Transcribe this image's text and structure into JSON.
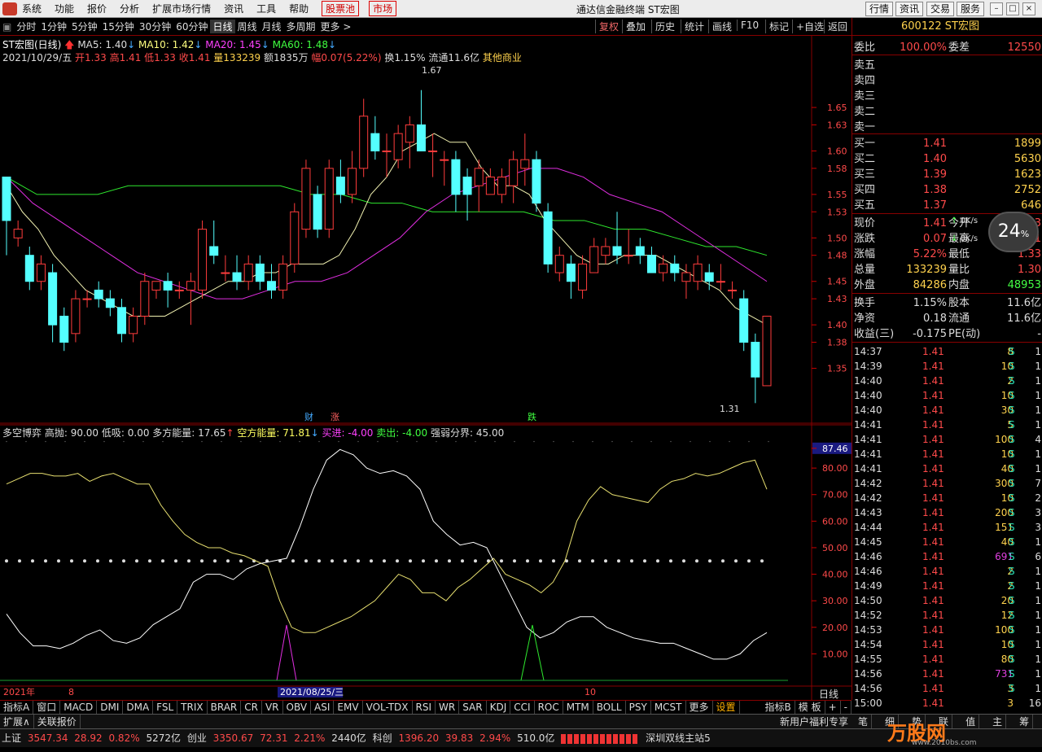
{
  "menu": {
    "items": [
      "系统",
      "功能",
      "报价",
      "分析",
      "扩展市场行情",
      "资讯",
      "工具",
      "帮助"
    ],
    "hl1": "股票池",
    "hl2": "市场",
    "window_title": "通达信金融终端 ST宏图",
    "right_buttons": [
      "行情",
      "资讯",
      "交易",
      "服务"
    ]
  },
  "toolbar": {
    "periods": [
      "分时",
      "1分钟",
      "5分钟",
      "15分钟",
      "30分钟",
      "60分钟",
      "日线",
      "周线",
      "月线",
      "多周期",
      "更多 >"
    ],
    "active": "日线",
    "right_buttons": [
      "复权",
      "叠加",
      "历史",
      "统计",
      "画线",
      "F10",
      "标记",
      "+自选",
      "返回"
    ]
  },
  "chart_header": {
    "name": "ST宏图(日线)",
    "ma5": "MA5: 1.40",
    "ma10": "MA10: 1.42",
    "ma20": "MA20: 1.45",
    "ma60": "MA60: 1.48",
    "date": "2021/10/29/五",
    "open": "开1.33",
    "high": "高1.41",
    "low": "低1.33",
    "close": "收1.41",
    "vol": "量133239",
    "amt": "额1835万",
    "chg": "幅0.07(5.22%)",
    "turnover": "换1.15%",
    "float": "流通11.6亿",
    "sector": "其他商业"
  },
  "indicator_header": {
    "name": "多空博弈",
    "high_throw": "高抛: 90.00",
    "low_buy": "低吸: 0.00",
    "long_power": "多方能量: 17.65",
    "short_power": "空方能量: 71.81",
    "buy": "买进: -4.00",
    "sell": "卖出: -4.00",
    "border": "强弱分界: 45.00"
  },
  "chart_data": {
    "type": "candlestick",
    "y_ticks": [
      1.65,
      1.63,
      1.6,
      1.58,
      1.55,
      1.53,
      1.5,
      1.48,
      1.45,
      1.43,
      1.4,
      1.38,
      1.35
    ],
    "ylim": [
      1.3,
      1.68
    ],
    "max_label": "1.67",
    "min_label": "1.31",
    "x_labels": [
      "2021年",
      "8",
      "2021/08/25/三",
      "10"
    ],
    "markers": [
      "财",
      "涨",
      "跌"
    ],
    "candles": [
      [
        1.57,
        1.52,
        1.56,
        1.48
      ],
      [
        1.5,
        1.51,
        1.52,
        1.49
      ],
      [
        1.48,
        1.45,
        1.49,
        1.44
      ],
      [
        1.45,
        1.47,
        1.48,
        1.44
      ],
      [
        1.46,
        1.4,
        1.47,
        1.38
      ],
      [
        1.41,
        1.38,
        1.42,
        1.37
      ],
      [
        1.39,
        1.43,
        1.44,
        1.38
      ],
      [
        1.43,
        1.43,
        1.44,
        1.42
      ],
      [
        1.44,
        1.43,
        1.45,
        1.42
      ],
      [
        1.43,
        1.42,
        1.44,
        1.41
      ],
      [
        1.42,
        1.39,
        1.43,
        1.38
      ],
      [
        1.39,
        1.41,
        1.42,
        1.38
      ],
      [
        1.41,
        1.45,
        1.46,
        1.4
      ],
      [
        1.44,
        1.45,
        1.45,
        1.43
      ],
      [
        1.45,
        1.44,
        1.46,
        1.42
      ],
      [
        1.44,
        1.44,
        1.45,
        1.43
      ],
      [
        1.44,
        1.45,
        1.46,
        1.4
      ],
      [
        1.44,
        1.51,
        1.52,
        1.43
      ],
      [
        1.49,
        1.48,
        1.52,
        1.47
      ],
      [
        1.46,
        1.46,
        1.48,
        1.45
      ],
      [
        1.46,
        1.45,
        1.48,
        1.44
      ],
      [
        1.45,
        1.47,
        1.48,
        1.44
      ],
      [
        1.47,
        1.45,
        1.48,
        1.44
      ],
      [
        1.45,
        1.44,
        1.47,
        1.43
      ],
      [
        1.44,
        1.47,
        1.48,
        1.43
      ],
      [
        1.47,
        1.53,
        1.54,
        1.46
      ],
      [
        1.51,
        1.58,
        1.59,
        1.5
      ],
      [
        1.55,
        1.51,
        1.56,
        1.5
      ],
      [
        1.51,
        1.58,
        1.59,
        1.5
      ],
      [
        1.57,
        1.55,
        1.59,
        1.54
      ],
      [
        1.55,
        1.58,
        1.6,
        1.54
      ],
      [
        1.58,
        1.64,
        1.66,
        1.57
      ],
      [
        1.62,
        1.6,
        1.64,
        1.59
      ],
      [
        1.6,
        1.6,
        1.62,
        1.57
      ],
      [
        1.59,
        1.62,
        1.63,
        1.58
      ],
      [
        1.61,
        1.63,
        1.64,
        1.58
      ],
      [
        1.63,
        1.6,
        1.67,
        1.6
      ],
      [
        1.6,
        1.6,
        1.62,
        1.57
      ],
      [
        1.59,
        1.59,
        1.6,
        1.56
      ],
      [
        1.59,
        1.55,
        1.6,
        1.53
      ],
      [
        1.57,
        1.55,
        1.58,
        1.52
      ],
      [
        1.56,
        1.58,
        1.59,
        1.53
      ],
      [
        1.55,
        1.57,
        1.58,
        1.55
      ],
      [
        1.55,
        1.57,
        1.58,
        1.54
      ],
      [
        1.56,
        1.59,
        1.6,
        1.54
      ],
      [
        1.58,
        1.59,
        1.62,
        1.56
      ],
      [
        1.59,
        1.54,
        1.6,
        1.53
      ],
      [
        1.53,
        1.47,
        1.54,
        1.46
      ],
      [
        1.46,
        1.48,
        1.49,
        1.45
      ],
      [
        1.47,
        1.45,
        1.48,
        1.43
      ],
      [
        1.44,
        1.47,
        1.48,
        1.43
      ],
      [
        1.46,
        1.49,
        1.5,
        1.46
      ],
      [
        1.48,
        1.49,
        1.5,
        1.47
      ],
      [
        1.49,
        1.48,
        1.53,
        1.47
      ],
      [
        1.48,
        1.48,
        1.51,
        1.47
      ],
      [
        1.49,
        1.48,
        1.5,
        1.47
      ],
      [
        1.48,
        1.46,
        1.49,
        1.46
      ],
      [
        1.46,
        1.47,
        1.48,
        1.45
      ],
      [
        1.47,
        1.46,
        1.48,
        1.45
      ],
      [
        1.45,
        1.46,
        1.47,
        1.43
      ],
      [
        1.45,
        1.47,
        1.48,
        1.44
      ],
      [
        1.46,
        1.45,
        1.47,
        1.44
      ],
      [
        1.45,
        1.45,
        1.47,
        1.44
      ],
      [
        1.44,
        1.44,
        1.45,
        1.43
      ],
      [
        1.43,
        1.38,
        1.44,
        1.37
      ],
      [
        1.38,
        1.34,
        1.39,
        1.31
      ],
      [
        1.33,
        1.41,
        1.41,
        1.33
      ]
    ],
    "ind_ticks": [
      87.46,
      80.0,
      70.0,
      60.0,
      50.0,
      40.0,
      30.0,
      20.0,
      10.0
    ],
    "long_line": [
      74,
      76,
      78,
      78,
      77,
      77,
      78,
      75,
      77,
      78,
      76,
      74,
      74,
      66,
      60,
      55,
      52,
      50,
      50,
      48,
      47,
      45,
      43,
      30,
      20,
      18,
      18,
      20,
      22,
      24,
      27,
      30,
      35,
      40,
      38,
      33,
      33,
      30,
      35,
      38,
      42,
      46,
      40,
      38,
      36,
      33,
      37,
      45,
      60,
      68,
      73,
      70,
      69,
      68,
      67,
      72,
      75,
      76,
      78,
      77,
      78,
      80,
      82,
      83,
      72
    ],
    "short_line": [
      25,
      18,
      13,
      13,
      12,
      14,
      17,
      19,
      15,
      14,
      16,
      21,
      24,
      27,
      37,
      40,
      40,
      38,
      42,
      44,
      45,
      46,
      58,
      72,
      83,
      87,
      85,
      80,
      78,
      79,
      77,
      72,
      60,
      55,
      51,
      52,
      50,
      40,
      30,
      20,
      16,
      18,
      22,
      24,
      24,
      20,
      18,
      16,
      15,
      14,
      14,
      12,
      10,
      8,
      8,
      10,
      15,
      18
    ],
    "ma5": [
      1.56,
      1.53,
      1.51,
      1.48,
      1.46,
      1.44,
      1.43,
      1.42,
      1.41,
      1.41,
      1.41,
      1.42,
      1.43,
      1.44,
      1.45,
      1.45,
      1.46,
      1.46,
      1.47,
      1.47,
      1.47,
      1.48,
      1.51,
      1.55,
      1.57,
      1.6,
      1.61,
      1.62,
      1.61,
      1.61,
      1.58,
      1.56,
      1.56,
      1.55,
      1.52,
      1.5,
      1.48,
      1.47,
      1.47,
      1.48,
      1.48,
      1.48,
      1.47,
      1.46,
      1.45,
      1.44,
      1.42,
      1.41,
      1.4
    ],
    "ma60": [
      1.57,
      1.55,
      1.55,
      1.55,
      1.56,
      1.56,
      1.56,
      1.56,
      1.56,
      1.56,
      1.55,
      1.55,
      1.54,
      1.54,
      1.53,
      1.53,
      1.53,
      1.53,
      1.52,
      1.52,
      1.51,
      1.51,
      1.5,
      1.49,
      1.49,
      1.48
    ],
    "ma20": [
      1.57,
      1.54,
      1.52,
      1.5,
      1.48,
      1.46,
      1.45,
      1.44,
      1.43,
      1.43,
      1.44,
      1.45,
      1.45,
      1.46,
      1.48,
      1.5,
      1.53,
      1.55,
      1.56,
      1.57,
      1.58,
      1.58,
      1.57,
      1.55,
      1.54,
      1.53,
      1.51,
      1.49,
      1.47,
      1.45
    ]
  },
  "quote": {
    "code": "600122 ST宏图",
    "weibi_label": "委比",
    "weibi": "100.00%",
    "weicha_label": "委差",
    "weicha": "12550",
    "asks": [
      "卖五",
      "卖四",
      "卖三",
      "卖二",
      "卖一"
    ],
    "bids": [
      {
        "l": "买一",
        "p": "1.41",
        "v": "1899"
      },
      {
        "l": "买二",
        "p": "1.40",
        "v": "5630"
      },
      {
        "l": "买三",
        "p": "1.39",
        "v": "1623"
      },
      {
        "l": "买四",
        "p": "1.38",
        "v": "2752"
      },
      {
        "l": "买五",
        "p": "1.37",
        "v": "646"
      }
    ],
    "stats1": [
      {
        "l": "现价",
        "v": "1.41",
        "l2": "今开",
        "v2": "1.33"
      },
      {
        "l": "涨跌",
        "v": "0.07",
        "l2": "最高",
        "v2": "1.41"
      },
      {
        "l": "涨幅",
        "v": "5.22%",
        "l2": "最低",
        "v2": "1.33"
      },
      {
        "l": "总量",
        "v": "133239",
        "l2": "量比",
        "v2": "1.30"
      },
      {
        "l": "外盘",
        "v": "84286",
        "l2": "内盘",
        "v2": "48953"
      }
    ],
    "stats2": [
      {
        "l": "换手",
        "v": "1.15%",
        "l2": "股本",
        "v2": "11.6亿"
      },
      {
        "l": "净资",
        "v": "0.18",
        "l2": "流通",
        "v2": "11.6亿"
      },
      {
        "l": "收益(三)",
        "v": "-0.175",
        "l2": "PE(动)",
        "v2": "-"
      }
    ],
    "speed_up": "0K/s",
    "speed_down": "0K/s",
    "dial": "24"
  },
  "ticks": [
    [
      "14:37",
      "1.41",
      "8",
      "S",
      "1"
    ],
    [
      "14:39",
      "1.41",
      "10",
      "S",
      "1"
    ],
    [
      "14:40",
      "1.41",
      "2",
      "S",
      "1"
    ],
    [
      "14:40",
      "1.41",
      "10",
      "S",
      "1"
    ],
    [
      "14:40",
      "1.41",
      "30",
      "S",
      "1"
    ],
    [
      "14:41",
      "1.41",
      "5",
      "S",
      "1"
    ],
    [
      "14:41",
      "1.41",
      "100",
      "S",
      "4"
    ],
    [
      "14:41",
      "1.41",
      "10",
      "S",
      "1"
    ],
    [
      "14:41",
      "1.41",
      "40",
      "S",
      "1"
    ],
    [
      "14:42",
      "1.41",
      "300",
      "S",
      "7"
    ],
    [
      "14:42",
      "1.41",
      "10",
      "S",
      "2"
    ],
    [
      "14:43",
      "1.41",
      "200",
      "S",
      "3"
    ],
    [
      "14:44",
      "1.41",
      "151",
      "S",
      "3"
    ],
    [
      "14:45",
      "1.41",
      "40",
      "S",
      "1"
    ],
    [
      "14:46",
      "1.41",
      "691",
      "S",
      "6"
    ],
    [
      "14:46",
      "1.41",
      "2",
      "S",
      "1"
    ],
    [
      "14:49",
      "1.41",
      "2",
      "S",
      "1"
    ],
    [
      "14:50",
      "1.41",
      "20",
      "S",
      "1"
    ],
    [
      "14:52",
      "1.41",
      "12",
      "S",
      "1"
    ],
    [
      "14:53",
      "1.41",
      "100",
      "S",
      "1"
    ],
    [
      "14:54",
      "1.41",
      "10",
      "S",
      "1"
    ],
    [
      "14:55",
      "1.41",
      "80",
      "S",
      "1"
    ],
    [
      "14:56",
      "1.41",
      "731",
      "S",
      "1"
    ],
    [
      "14:56",
      "1.41",
      "3",
      "S",
      "1"
    ],
    [
      "15:00",
      "1.41",
      "3",
      "",
      "16"
    ]
  ],
  "indicator_bar": [
    "指标A",
    "窗口",
    "MACD",
    "DMI",
    "DMA",
    "FSL",
    "TRIX",
    "BRAR",
    "CR",
    "VR",
    "OBV",
    "ASI",
    "EMV",
    "VOL-TDX",
    "RSI",
    "WR",
    "SAR",
    "KDJ",
    "CCI",
    "ROC",
    "MTM",
    "BOLL",
    "PSY",
    "MCST",
    "更多",
    "设置"
  ],
  "indicator_bar_right": [
    "指标B",
    "模 板",
    "+",
    "-"
  ],
  "bar2": {
    "left": [
      "扩展∧",
      "关联报价"
    ],
    "mid": "新用户福利专享",
    "right": [
      "笔",
      "细",
      "势",
      "联",
      "值",
      "主",
      "筹"
    ],
    "period_label": "日线"
  },
  "status": {
    "sh_label": "上证",
    "sh": "3547.34",
    "sh_chg": "28.92",
    "sh_pct": "0.82%",
    "sh_amt": "5272亿",
    "cy_label": "创业",
    "cy": "3350.67",
    "cy_chg": "72.31",
    "cy_pct": "2.21%",
    "cy_amt": "2440亿",
    "kc_label": "科创",
    "kc": "1396.20",
    "kc_chg": "39.83",
    "kc_pct": "2.94%",
    "kc_amt": "510.0亿",
    "station": "深圳双线主站5",
    "wm": "万股网",
    "wm_url": "www.2010bs.com"
  }
}
